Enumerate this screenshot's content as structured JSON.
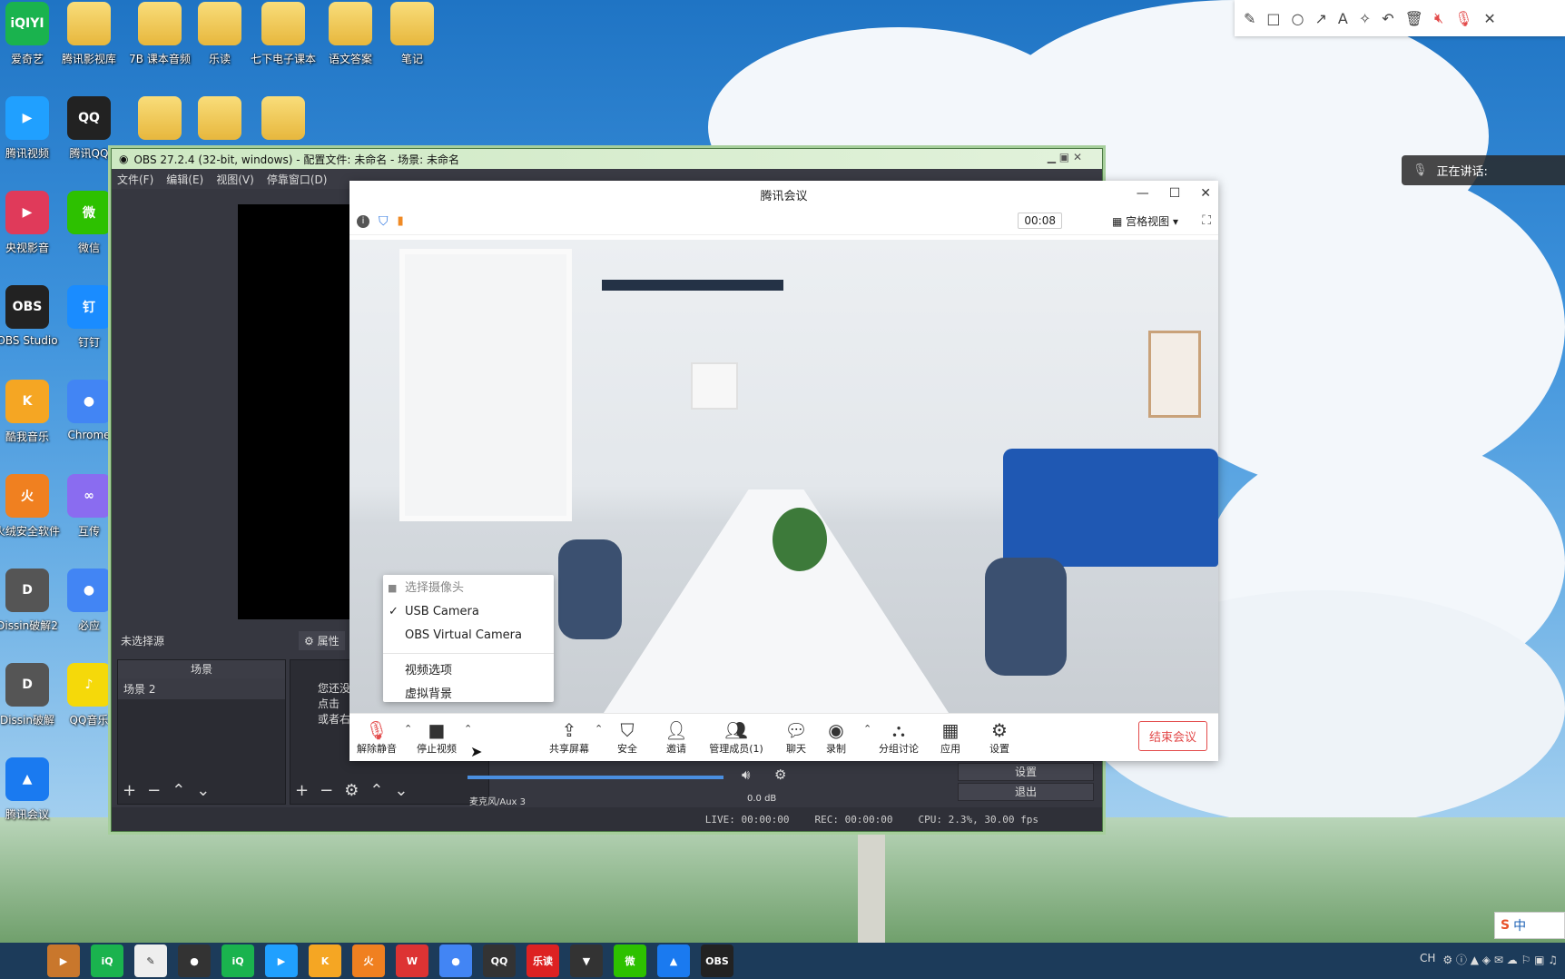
{
  "desktop": {
    "icons": [
      {
        "label": "爱奇艺",
        "icon": "iqiyi-icon",
        "color": "#1ab34e",
        "text": "iQIYI"
      },
      {
        "label": "腾讯影视库",
        "icon": "folder-icon",
        "folder": true
      },
      {
        "label": "7B 课本音频",
        "icon": "folder-icon",
        "folder": true
      },
      {
        "label": "乐读",
        "icon": "folder-icon",
        "folder": true
      },
      {
        "label": "七下电子课本",
        "icon": "folder-icon",
        "folder": true
      },
      {
        "label": "语文答案",
        "icon": "folder-icon",
        "folder": true
      },
      {
        "label": "笔记",
        "icon": "folder-icon",
        "folder": true
      },
      {
        "label": "腾讯视频",
        "icon": "tencent-video-icon",
        "color": "#20a0ff",
        "text": "▶"
      },
      {
        "label": "腾讯QQ",
        "icon": "qq-icon",
        "color": "#222",
        "text": "QQ"
      },
      {
        "label": "",
        "icon": "folder-icon",
        "folder": true
      },
      {
        "label": "",
        "icon": "folder-icon",
        "folder": true
      },
      {
        "label": "",
        "icon": "folder-icon",
        "folder": true
      },
      {
        "label": "央视影音",
        "icon": "cctv-icon",
        "color": "#e03a5a",
        "text": "▶"
      },
      {
        "label": "微信",
        "icon": "wechat-icon",
        "color": "#2dc100",
        "text": "微"
      },
      {
        "label": "OBS Studio",
        "icon": "obs-icon",
        "color": "#222",
        "text": "OBS"
      },
      {
        "label": "钉钉",
        "icon": "dingtalk-icon",
        "color": "#1a8cff",
        "text": "钉"
      },
      {
        "label": "酷我音乐",
        "icon": "kuwo-icon",
        "color": "#f5a623",
        "text": "K"
      },
      {
        "label": "Chrome",
        "icon": "chrome-icon",
        "color": "#4285f4",
        "text": "●"
      },
      {
        "label": "火绒安全软件",
        "icon": "huorong-icon",
        "color": "#f08020",
        "text": "火"
      },
      {
        "label": "互传",
        "icon": "hucun-icon",
        "color": "#8a6cf0",
        "text": "∞"
      },
      {
        "label": "Dissin破解2",
        "icon": "app-icon",
        "color": "#555",
        "text": "D"
      },
      {
        "label": "必应",
        "icon": "chrome-icon",
        "color": "#4285f4",
        "text": "●"
      },
      {
        "label": "Dissin破解",
        "icon": "app-icon",
        "color": "#555",
        "text": "D"
      },
      {
        "label": "QQ音乐",
        "icon": "qqmusic-icon",
        "color": "#f5d90a",
        "text": "♪"
      },
      {
        "label": "腾讯会议",
        "icon": "tencent-meeting-icon",
        "color": "#1a7af0",
        "text": "▲"
      }
    ]
  },
  "obs": {
    "title": "OBS 27.2.4 (32-bit, windows) - 配置文件: 未命名 - 场景: 未命名",
    "menu": [
      "文件(F)",
      "编辑(E)",
      "视图(V)",
      "停靠窗口(D)"
    ],
    "no_source": "未选择源",
    "properties": "属性",
    "scenes_header": "场景",
    "scene_item": "场景 2",
    "sources_hint": [
      "您还没",
      "点击",
      "或者右"
    ],
    "side_settings": "设置",
    "side_exit": "退出",
    "audio_label": "麦克风/Aux 3",
    "audio_db": "0.0 dB",
    "status_live": "LIVE: 00:00:00",
    "status_rec": "REC: 00:00:00",
    "status_cpu": "CPU: 2.3%, 30.00 fps"
  },
  "meeting": {
    "title": "腾讯会议",
    "timer": "00:08",
    "view_mode": "宫格视图",
    "toolbar": {
      "unmute": "解除静音",
      "stop_video": "停止视频",
      "share": "共享屏幕",
      "security": "安全",
      "invite": "邀请",
      "members": "管理成员(1)",
      "chat": "聊天",
      "record": "录制",
      "breakout": "分组讨论",
      "apps": "应用",
      "settings": "设置",
      "end": "结束会议"
    }
  },
  "camera_menu": {
    "header": "选择摄像头",
    "items": [
      "USB Camera",
      "OBS Virtual Camera"
    ],
    "selected": "USB Camera",
    "options": [
      "视频选项",
      "虚拟背景"
    ]
  },
  "speaking": {
    "label": "正在讲话:"
  },
  "ime": {
    "label": "中"
  },
  "taskbar": {
    "apps": [
      {
        "icon": "media-player-icon",
        "color": "#c9772c",
        "text": "▶"
      },
      {
        "icon": "iqiyi-icon",
        "color": "#1ab34e",
        "text": "iQ"
      },
      {
        "icon": "paint-icon",
        "color": "#eee",
        "text": "✎"
      },
      {
        "icon": "record-icon",
        "color": "#333",
        "text": "●"
      },
      {
        "icon": "iqiyi-icon",
        "color": "#1ab34e",
        "text": "iQ"
      },
      {
        "icon": "tencent-video-icon",
        "color": "#20a0ff",
        "text": "▶"
      },
      {
        "icon": "kuwo-icon",
        "color": "#f5a623",
        "text": "K"
      },
      {
        "icon": "huorong-icon",
        "color": "#f08020",
        "text": "火"
      },
      {
        "icon": "wps-icon",
        "color": "#d33",
        "text": "W"
      },
      {
        "icon": "chrome-icon",
        "color": "#4285f4",
        "text": "●"
      },
      {
        "icon": "qq-icon",
        "color": "#333",
        "text": "QQ"
      },
      {
        "icon": "ledu-icon",
        "color": "#d22",
        "text": "乐读"
      },
      {
        "icon": "app-icon",
        "color": "#333",
        "text": "▼"
      },
      {
        "icon": "wechat-icon",
        "color": "#2dc100",
        "text": "微"
      },
      {
        "icon": "tencent-meeting-icon",
        "color": "#1a7af0",
        "text": "▲"
      },
      {
        "icon": "obs-icon",
        "color": "#222",
        "text": "OBS"
      }
    ],
    "tray_lang": "CH"
  }
}
